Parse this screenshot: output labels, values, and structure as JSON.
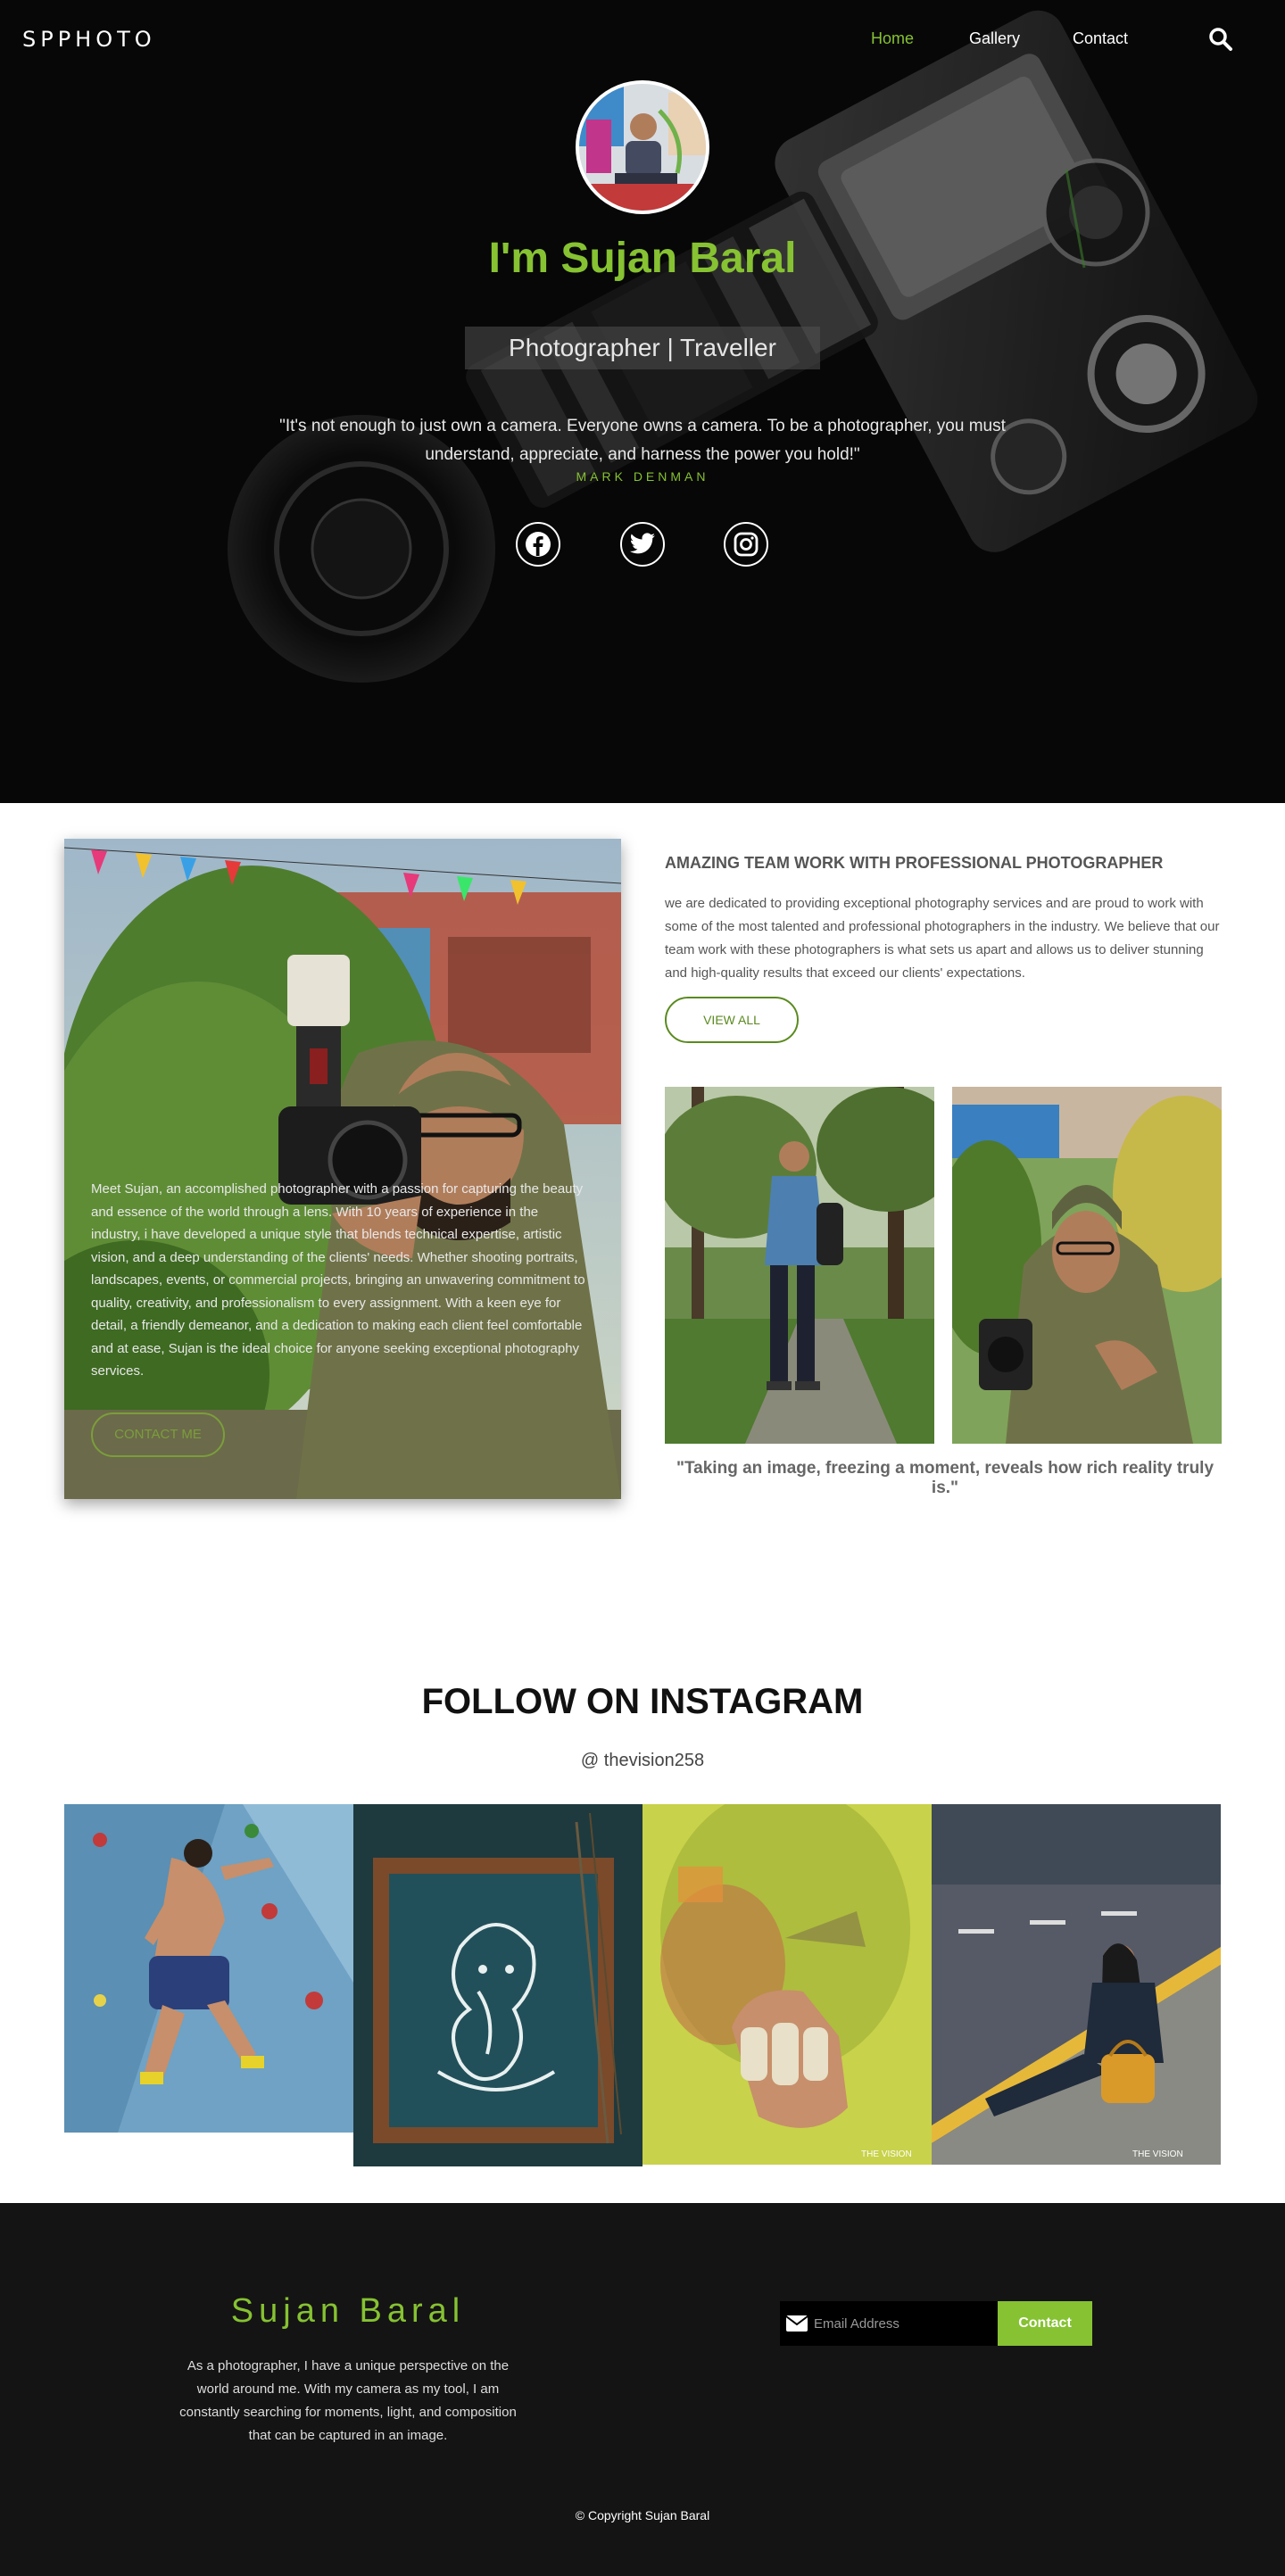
{
  "nav": {
    "logo": "SPPHOTO",
    "links": [
      "Home",
      "Gallery",
      "Contact"
    ],
    "search_icon": "search-icon",
    "accent_color": "#86c232"
  },
  "hero": {
    "title": "I'm Sujan Baral",
    "tagline": "Photographer | Traveller",
    "quote": "\"It's not enough to just own a camera. Everyone owns a camera. To be a photographer, you must understand, appreciate, and harness the power you hold!\"",
    "quote_author": "MARK DENMAN",
    "social_icons": [
      "facebook-icon",
      "twitter-icon",
      "instagram-icon"
    ]
  },
  "about": {
    "description": "Meet Sujan, an accomplished photographer with a passion for capturing the beauty and essence of the world through a lens. With 10 years of experience in the industry, i have developed a unique style that blends technical expertise, artistic vision, and a deep understanding of the clients' needs. Whether shooting portraits, landscapes, events, or commercial projects, bringing an unwavering commitment to quality, creativity, and professionalism to every assignment. With a keen eye for detail, a friendly demeanor, and a dedication to making each client feel comfortable and at ease, Sujan is the ideal choice for anyone seeking exceptional photography services.",
    "contact_label": "CONTACT ME",
    "heading": "AMAZING TEAM WORK WITH PROFESSIONAL PHOTOGRAPHER",
    "paragraph": "we are dedicated to providing exceptional photography services and are proud to work with some of the most talented and professional photographers in the industry. We believe that our team work with these photographers is what sets us apart and allows us to deliver stunning and high-quality results that exceed our clients' expectations.",
    "view_all_label": "VIEW ALL",
    "quote": "\"Taking an image, freezing a moment, reveals how rich reality truly is.\""
  },
  "instagram": {
    "title": "FOLLOW ON INSTAGRAM",
    "handle": "@ thevision258",
    "watermark": "THE VISION"
  },
  "footer": {
    "name": "Sujan Baral",
    "paragraph": "As a photographer, I have a unique perspective on the world around me. With my camera as my tool, I am constantly searching for moments, light, and composition that can be captured in an image.",
    "email_placeholder": "Email Address",
    "contact_label": "Contact",
    "copyright": "© Copyright Sujan Baral"
  }
}
